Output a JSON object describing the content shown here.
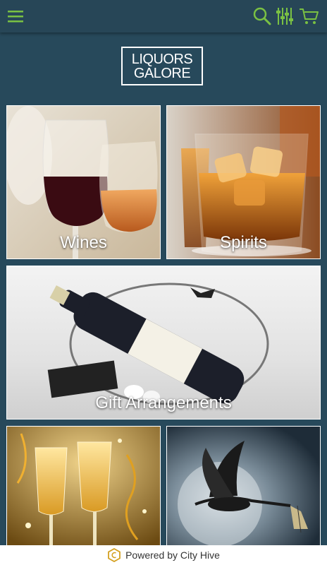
{
  "brand": {
    "line1": "LIQUORS",
    "line2": "GALORE"
  },
  "colors": {
    "accent": "#7ac143",
    "header_bg": "#274657",
    "page_bg": "#27495b"
  },
  "header": {
    "icons": [
      "menu-icon",
      "search-icon",
      "filter-icon",
      "cart-icon"
    ]
  },
  "tiles": [
    {
      "label": "Wines"
    },
    {
      "label": "Spirits"
    },
    {
      "label": "Gift Arrangements"
    },
    {
      "label": ""
    },
    {
      "label": ""
    }
  ],
  "footer": {
    "text": "Powered by City Hive"
  }
}
